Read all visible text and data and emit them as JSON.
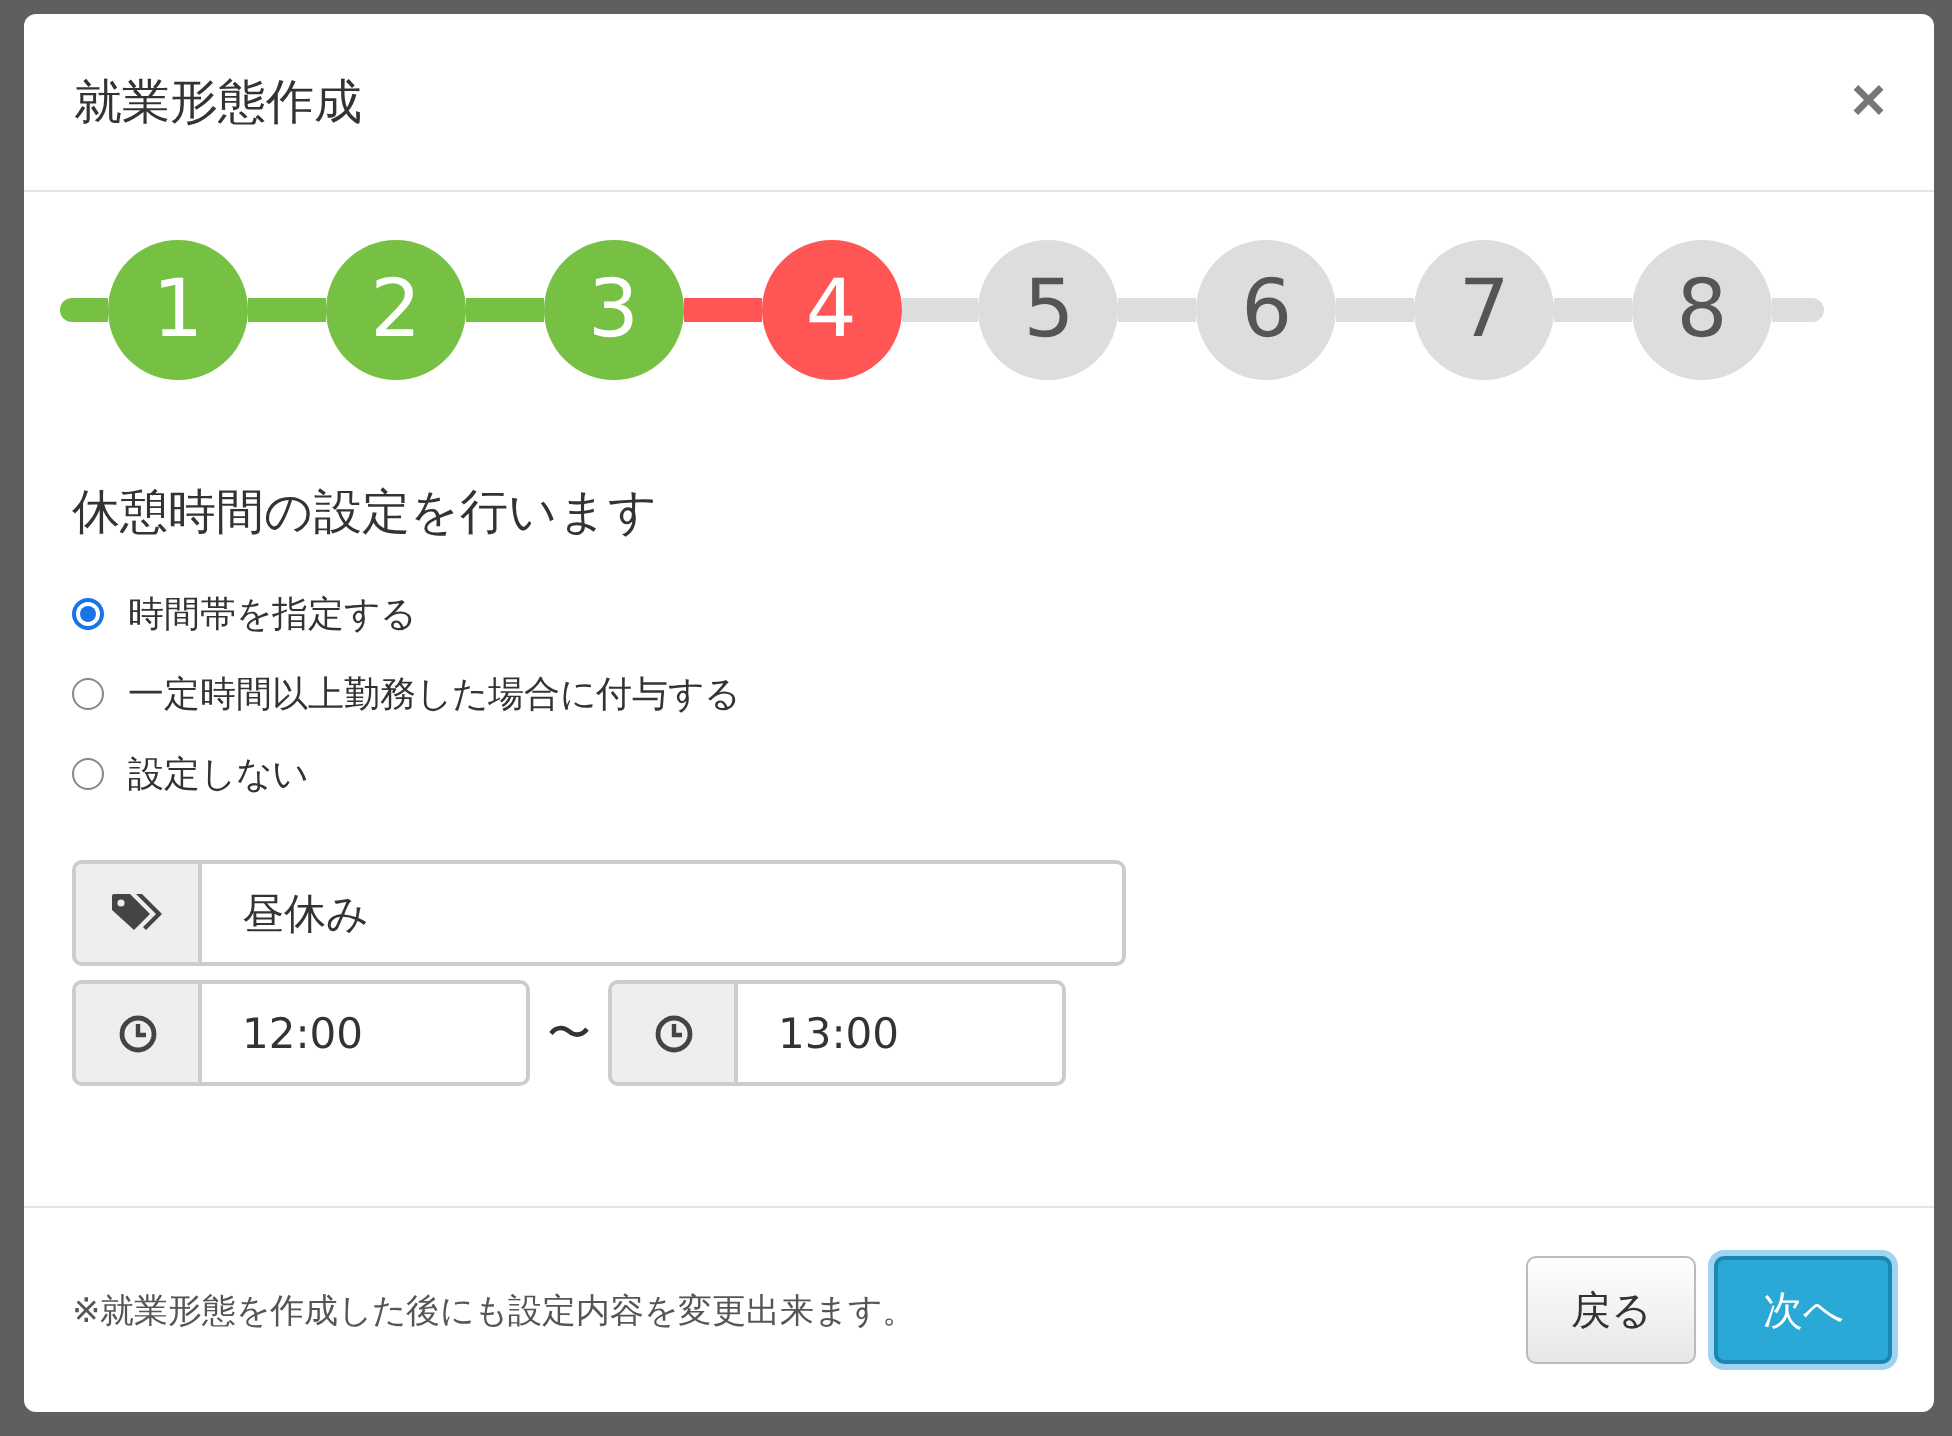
{
  "dialog": {
    "title": "就業形態作成",
    "close": "×"
  },
  "steps": [
    {
      "label": "1",
      "kind": "done"
    },
    {
      "label": "2",
      "kind": "done"
    },
    {
      "label": "3",
      "kind": "done"
    },
    {
      "label": "4",
      "kind": "current"
    },
    {
      "label": "5",
      "kind": "pending"
    },
    {
      "label": "6",
      "kind": "pending"
    },
    {
      "label": "7",
      "kind": "pending"
    },
    {
      "label": "8",
      "kind": "pending"
    }
  ],
  "heading": "休憩時間の設定を行います",
  "options": [
    {
      "label": "時間帯を指定する",
      "selected": true
    },
    {
      "label": "一定時間以上勤務した場合に付与する",
      "selected": false
    },
    {
      "label": "設定しない",
      "selected": false
    }
  ],
  "name_field": {
    "value": "昼休み"
  },
  "time_range": {
    "start": "12:00",
    "separator": "〜",
    "end": "13:00"
  },
  "footer": {
    "note": "※就業形態を作成した後にも設定内容を変更出来ます。",
    "back_button": "戻る",
    "next_button": "次へ"
  }
}
